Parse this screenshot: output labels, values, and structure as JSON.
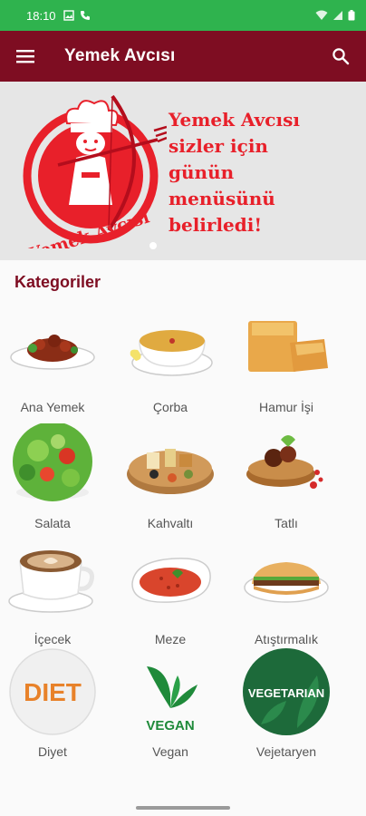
{
  "status_bar": {
    "time": "18:10"
  },
  "app_bar": {
    "title": "Yemek Avcısı"
  },
  "banner": {
    "logo_text": "Yemek Avcısı",
    "slogan_lines": [
      "Yemek Avcısı",
      "sizler için",
      "günün",
      "menüsünü",
      "belirledi!"
    ],
    "active_slide": 1,
    "slide_count": 2
  },
  "categories_title": "Kategoriler",
  "categories": [
    {
      "label": "Ana Yemek",
      "icon": "main-dish-image"
    },
    {
      "label": "Çorba",
      "icon": "soup-image"
    },
    {
      "label": "Hamur İşi",
      "icon": "pastry-image"
    },
    {
      "label": "Salata",
      "icon": "salad-image"
    },
    {
      "label": "Kahvaltı",
      "icon": "breakfast-image"
    },
    {
      "label": "Tatlı",
      "icon": "dessert-image"
    },
    {
      "label": "İçecek",
      "icon": "drink-image"
    },
    {
      "label": "Meze",
      "icon": "appetizer-image"
    },
    {
      "label": "Atıştırmalık",
      "icon": "snack-image"
    },
    {
      "label": "Diyet",
      "icon": "diet-image",
      "image_text": "DIET"
    },
    {
      "label": "Vegan",
      "icon": "vegan-image",
      "image_text": "VEGAN"
    },
    {
      "label": "Vejetaryen",
      "icon": "vegetarian-image",
      "image_text": "VEGETARIAN"
    }
  ],
  "colors": {
    "status_bar": "#2fb34e",
    "app_bar": "#7e0d22",
    "accent_red": "#e8202a",
    "title": "#7e0d22"
  }
}
